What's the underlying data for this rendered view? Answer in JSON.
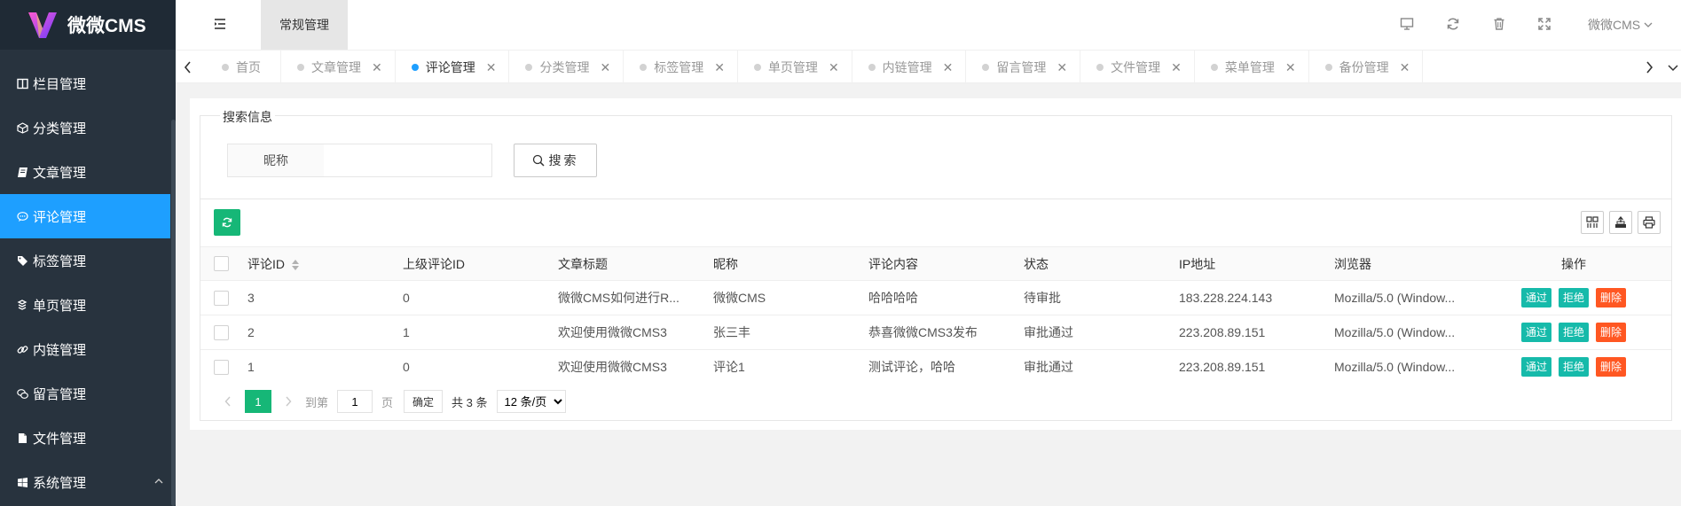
{
  "app": {
    "logo_text": "微微CMS"
  },
  "header": {
    "active_tab": "常规管理",
    "user_name": "微微CMS"
  },
  "sidebar": {
    "items": [
      {
        "label": "栏目管理",
        "icon": "columns-icon"
      },
      {
        "label": "分类管理",
        "icon": "cube-icon"
      },
      {
        "label": "文章管理",
        "icon": "book-icon"
      },
      {
        "label": "评论管理",
        "icon": "comment-icon"
      },
      {
        "label": "标签管理",
        "icon": "tags-icon"
      },
      {
        "label": "单页管理",
        "icon": "stack-icon"
      },
      {
        "label": "内链管理",
        "icon": "link-icon"
      },
      {
        "label": "留言管理",
        "icon": "comments-icon"
      },
      {
        "label": "文件管理",
        "icon": "file-icon"
      },
      {
        "label": "系统管理",
        "icon": "windows-icon"
      }
    ]
  },
  "tabs": [
    {
      "label": "首页"
    },
    {
      "label": "文章管理"
    },
    {
      "label": "评论管理"
    },
    {
      "label": "分类管理"
    },
    {
      "label": "标签管理"
    },
    {
      "label": "单页管理"
    },
    {
      "label": "内链管理"
    },
    {
      "label": "留言管理"
    },
    {
      "label": "文件管理"
    },
    {
      "label": "菜单管理"
    },
    {
      "label": "备份管理"
    }
  ],
  "search": {
    "legend": "搜索信息",
    "nickname_label": "昵称",
    "nickname_value": "",
    "button_label": "搜索"
  },
  "table": {
    "columns": [
      "评论ID",
      "上级评论ID",
      "文章标题",
      "昵称",
      "评论内容",
      "状态",
      "IP地址",
      "浏览器",
      "操作"
    ],
    "rows": [
      {
        "id": "3",
        "parent_id": "0",
        "title": "微微CMS如何进行R...",
        "nickname": "微微CMS",
        "content": "哈哈哈哈",
        "status": "待审批",
        "ip": "183.228.224.143",
        "browser": "Mozilla/5.0 (Window..."
      },
      {
        "id": "2",
        "parent_id": "1",
        "title": "欢迎使用微微CMS3",
        "nickname": "张三丰",
        "content": "恭喜微微CMS3发布",
        "status": "审批通过",
        "ip": "223.208.89.151",
        "browser": "Mozilla/5.0 (Window..."
      },
      {
        "id": "1",
        "parent_id": "0",
        "title": "欢迎使用微微CMS3",
        "nickname": "评论1",
        "content": "测试评论，哈哈",
        "status": "审批通过",
        "ip": "223.208.89.151",
        "browser": "Mozilla/5.0 (Window..."
      }
    ],
    "actions": {
      "approve": "通过",
      "reject": "拒绝",
      "delete": "删除"
    }
  },
  "pager": {
    "current_page": "1",
    "goto_label": "到第",
    "goto_value": "1",
    "page_suffix": "页",
    "confirm_label": "确定",
    "total_text": "共 3 条",
    "page_size_option": "12 条/页"
  },
  "colors": {
    "sidebar_bg": "#28333e",
    "active_blue": "#1e9fff",
    "green": "#16b777",
    "teal": "#16baaa",
    "danger": "#ff5722"
  }
}
